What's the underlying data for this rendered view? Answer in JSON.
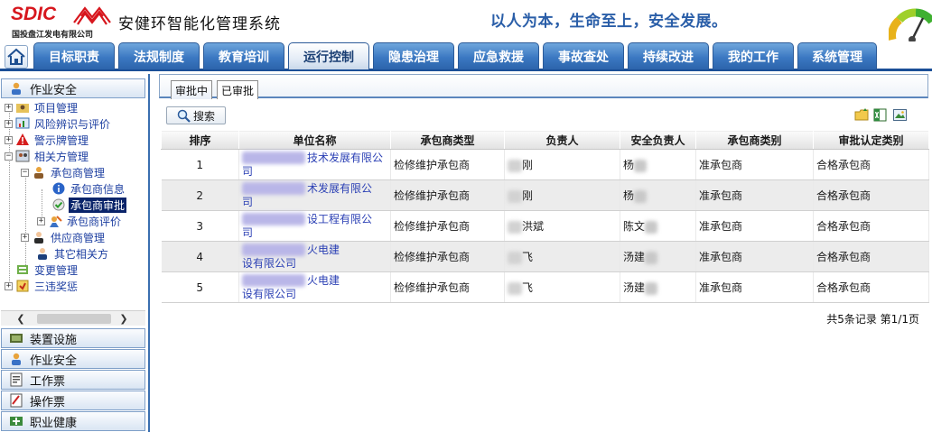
{
  "header": {
    "logo_text": "SDIC",
    "company": "国投盘江发电有限公司",
    "app_title": "安健环智能化管理系统",
    "slogan": "以人为本，生命至上，安全发展。"
  },
  "nav": {
    "home_icon": "home-icon",
    "tabs": [
      "目标职责",
      "法规制度",
      "教育培训",
      "运行控制",
      "隐患治理",
      "应急救援",
      "事故查处",
      "持续改进",
      "我的工作",
      "系统管理"
    ],
    "active": "运行控制"
  },
  "sidebar": {
    "top_section": "作业安全",
    "tree": [
      {
        "label": "项目管理",
        "icon": "folder-person-icon"
      },
      {
        "label": "风险辨识与评价",
        "icon": "chart-board-icon"
      },
      {
        "label": "警示牌管理",
        "icon": "warning-sign-icon"
      },
      {
        "label": "相关方管理",
        "icon": "people-icon"
      },
      {
        "label": "承包商管理",
        "icon": "worker-icon"
      },
      {
        "label": "承包商信息",
        "icon": "info-icon"
      },
      {
        "label": "承包商审批",
        "icon": "approve-icon"
      },
      {
        "label": "承包商评价",
        "icon": "evaluate-icon"
      },
      {
        "label": "供应商管理",
        "icon": "supplier-icon"
      },
      {
        "label": "其它相关方",
        "icon": "person-icon"
      },
      {
        "label": "变更管理",
        "icon": "change-icon"
      },
      {
        "label": "三违奖惩",
        "icon": "reward-icon"
      }
    ],
    "selected": "承包商审批",
    "sections": [
      "装置设施",
      "作业安全",
      "工作票",
      "操作票",
      "职业健康"
    ]
  },
  "content": {
    "subtabs": [
      "审批中",
      "已审批"
    ],
    "active_subtab": "审批中",
    "search_label": "搜索",
    "toolbar_icons": [
      "open-folder-icon",
      "export-excel-icon",
      "image-icon"
    ],
    "columns": [
      "排序",
      "单位名称",
      "承包商类型",
      "负责人",
      "安全负责人",
      "承包商类别",
      "审批认定类别"
    ],
    "rows": [
      {
        "idx": "1",
        "name_line1": "技术发展有限公",
        "name_line2": "司",
        "type": "检修维护承包商",
        "owner": "刚",
        "safety": "杨",
        "category": "准承包商",
        "approval": "合格承包商"
      },
      {
        "idx": "2",
        "name_line1": "术发展有限公",
        "name_line2": "司",
        "type": "检修维护承包商",
        "owner": "刚",
        "safety": "杨",
        "category": "准承包商",
        "approval": "合格承包商"
      },
      {
        "idx": "3",
        "name_line1": "设工程有限公",
        "name_line2": "司",
        "type": "检修维护承包商",
        "owner": "洪斌",
        "safety": "陈文",
        "category": "准承包商",
        "approval": "合格承包商"
      },
      {
        "idx": "4",
        "name_line1": "火电建",
        "name_line2": "设有限公司",
        "type": "检修维护承包商",
        "owner": "飞",
        "safety": "汤建",
        "category": "准承包商",
        "approval": "合格承包商"
      },
      {
        "idx": "5",
        "name_line1": "火电建",
        "name_line2": "设有限公司",
        "type": "检修维护承包商",
        "owner": "飞",
        "safety": "汤建",
        "category": "准承包商",
        "approval": "合格承包商"
      }
    ],
    "pager": "共5条记录 第1/1页"
  },
  "colors": {
    "tab_blue": "#3b78c2",
    "nav_border": "#1b4f97",
    "logo_red": "#d7161d",
    "slogan_blue": "#2a5ea8",
    "link_blue": "#2a3fb4",
    "selected_bg": "#0a246a"
  }
}
